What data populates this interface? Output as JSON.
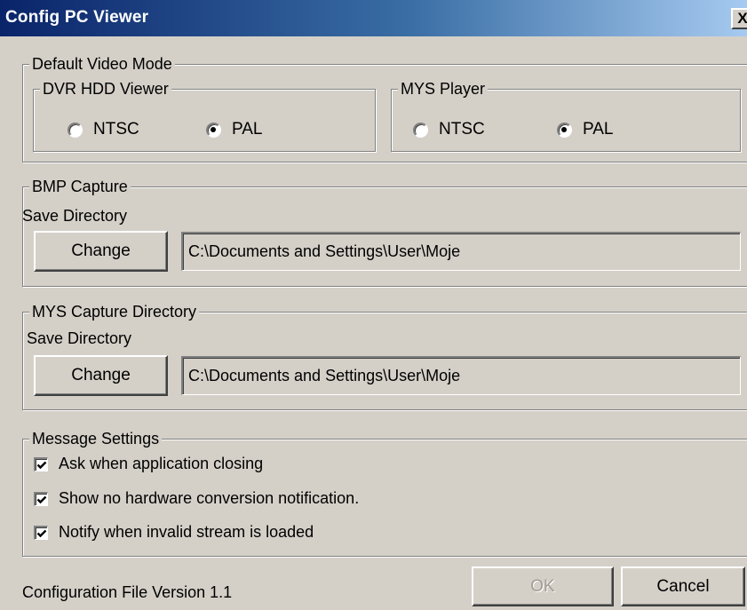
{
  "window": {
    "title": "Config PC Viewer",
    "close_glyph": "X"
  },
  "default_video_mode": {
    "legend": "Default Video Mode",
    "dvr_hdd_viewer": {
      "legend": "DVR HDD Viewer",
      "options": [
        "NTSC",
        "PAL"
      ],
      "selected": "PAL"
    },
    "mys_player": {
      "legend": "MYS Player",
      "options": [
        "NTSC",
        "PAL"
      ],
      "selected": "PAL"
    }
  },
  "bmp_capture": {
    "legend": "BMP Capture",
    "save_dir_label": "Save Directory",
    "change_label": "Change",
    "path": "C:\\Documents and Settings\\User\\Moje"
  },
  "mys_capture": {
    "legend": "MYS Capture Directory",
    "save_dir_label": "Save Directory",
    "change_label": "Change",
    "path": "C:\\Documents and Settings\\User\\Moje"
  },
  "message_settings": {
    "legend": "Message Settings",
    "items": [
      {
        "label": "Ask when application closing",
        "checked": true
      },
      {
        "label": "Show no hardware conversion notification.",
        "checked": true
      },
      {
        "label": "Notify when invalid stream is loaded",
        "checked": true
      }
    ]
  },
  "footer": {
    "version": "Configuration File Version 1.1",
    "ok_label": "OK",
    "cancel_label": "Cancel"
  },
  "colors": {
    "titlebar_start": "#0a246a",
    "titlebar_end": "#a6caf0",
    "face": "#d4d0c8"
  }
}
